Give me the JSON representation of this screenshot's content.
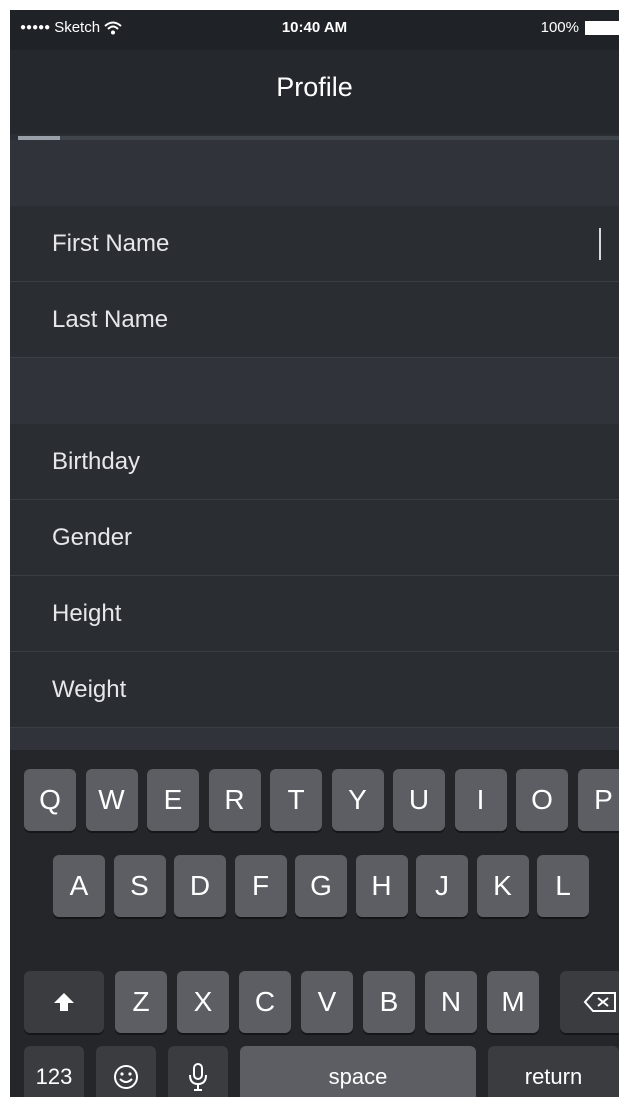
{
  "status_bar": {
    "signal": "●●●●●",
    "carrier": "Sketch",
    "wifi_icon": "wifi-icon",
    "time": "10:40 AM",
    "battery_percent": "100%",
    "battery_icon": "battery-icon"
  },
  "nav": {
    "title": "Profile",
    "progress": 0.07
  },
  "form": {
    "fields": [
      "First Name",
      "Last Name",
      "Birthday",
      "Gender",
      "Height",
      "Weight"
    ]
  },
  "keyboard": {
    "row1": [
      "Q",
      "W",
      "E",
      "R",
      "T",
      "Y",
      "U",
      "I",
      "O",
      "P"
    ],
    "row2": [
      "A",
      "S",
      "D",
      "F",
      "G",
      "H",
      "J",
      "K",
      "L"
    ],
    "row3": [
      "Z",
      "X",
      "C",
      "V",
      "B",
      "N",
      "M"
    ],
    "shift_icon": "shift-arrow-icon",
    "backspace_icon": "backspace-icon",
    "numbers_label": "123",
    "emoji_icon": "emoji-icon",
    "mic_icon": "microphone-icon",
    "space_label": "space",
    "return_label": "return"
  },
  "colors": {
    "background": "#2b2e34",
    "key": "#5c5e63",
    "key_dark": "#3a3c40",
    "text": "#ffffff"
  }
}
